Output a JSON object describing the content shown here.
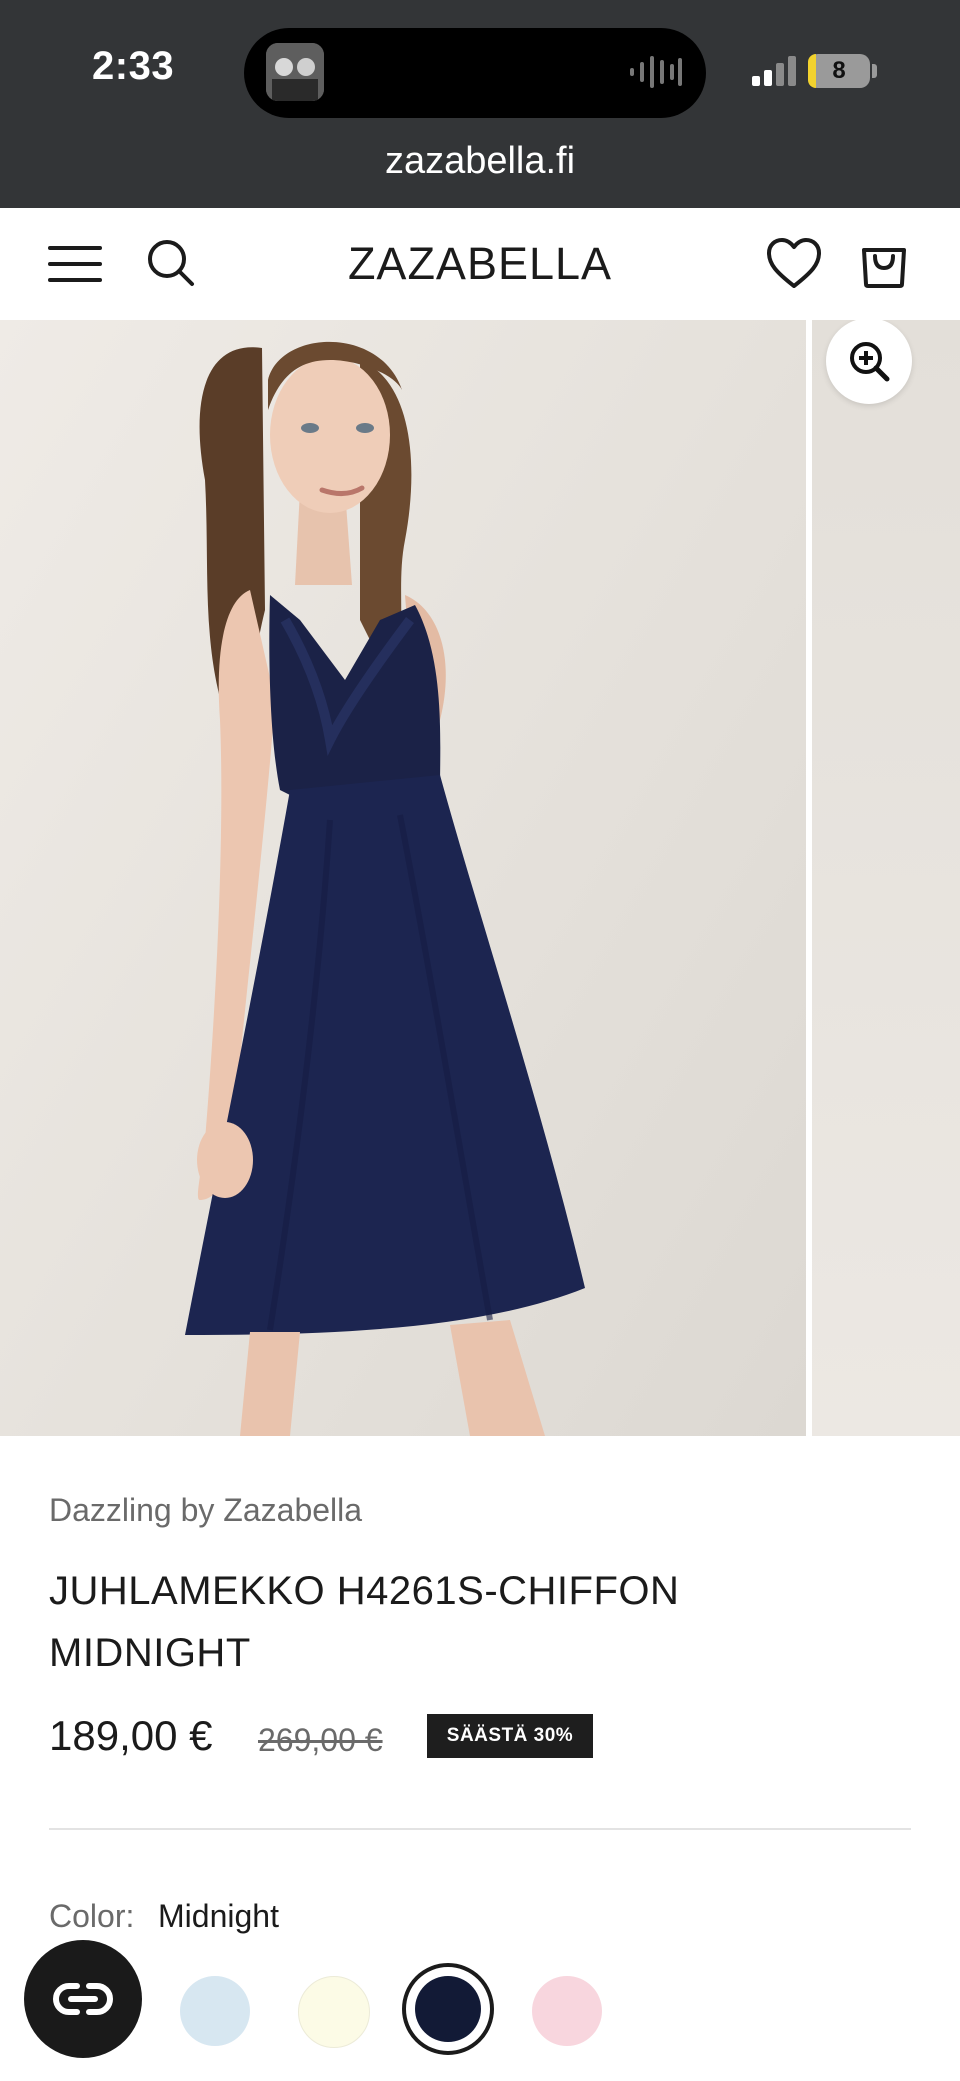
{
  "status_bar": {
    "time": "2:33",
    "battery": "8"
  },
  "browser": {
    "url": "zazabella.fi"
  },
  "header": {
    "logo": "ZAZABELLA"
  },
  "icons": {
    "menu": "menu-icon",
    "search": "search-icon",
    "wishlist": "heart-icon",
    "cart": "shopping-bag-icon",
    "zoom": "zoom-in-icon",
    "chat": "chat-icon"
  },
  "product": {
    "brand": "Dazzling by Zazabella",
    "title": "JUHLAMEKKO H4261S-CHIFFON MIDNIGHT",
    "price": "189,00 €",
    "old_price": "269,00 €",
    "badge": "SÄÄSTÄ 30%",
    "color_label": "Color:",
    "color_value": "Midnight",
    "swatches": [
      {
        "name": "light-blue",
        "color": "#d7e7f1"
      },
      {
        "name": "ivory",
        "color": "#fcfbe6"
      },
      {
        "name": "midnight",
        "color": "#121a36",
        "selected": true
      },
      {
        "name": "pink",
        "color": "#f8d6de"
      }
    ]
  },
  "colors": {
    "dark_bar": "#333537",
    "dress": "#1c2550",
    "badge_bg": "#1e1e1e"
  }
}
